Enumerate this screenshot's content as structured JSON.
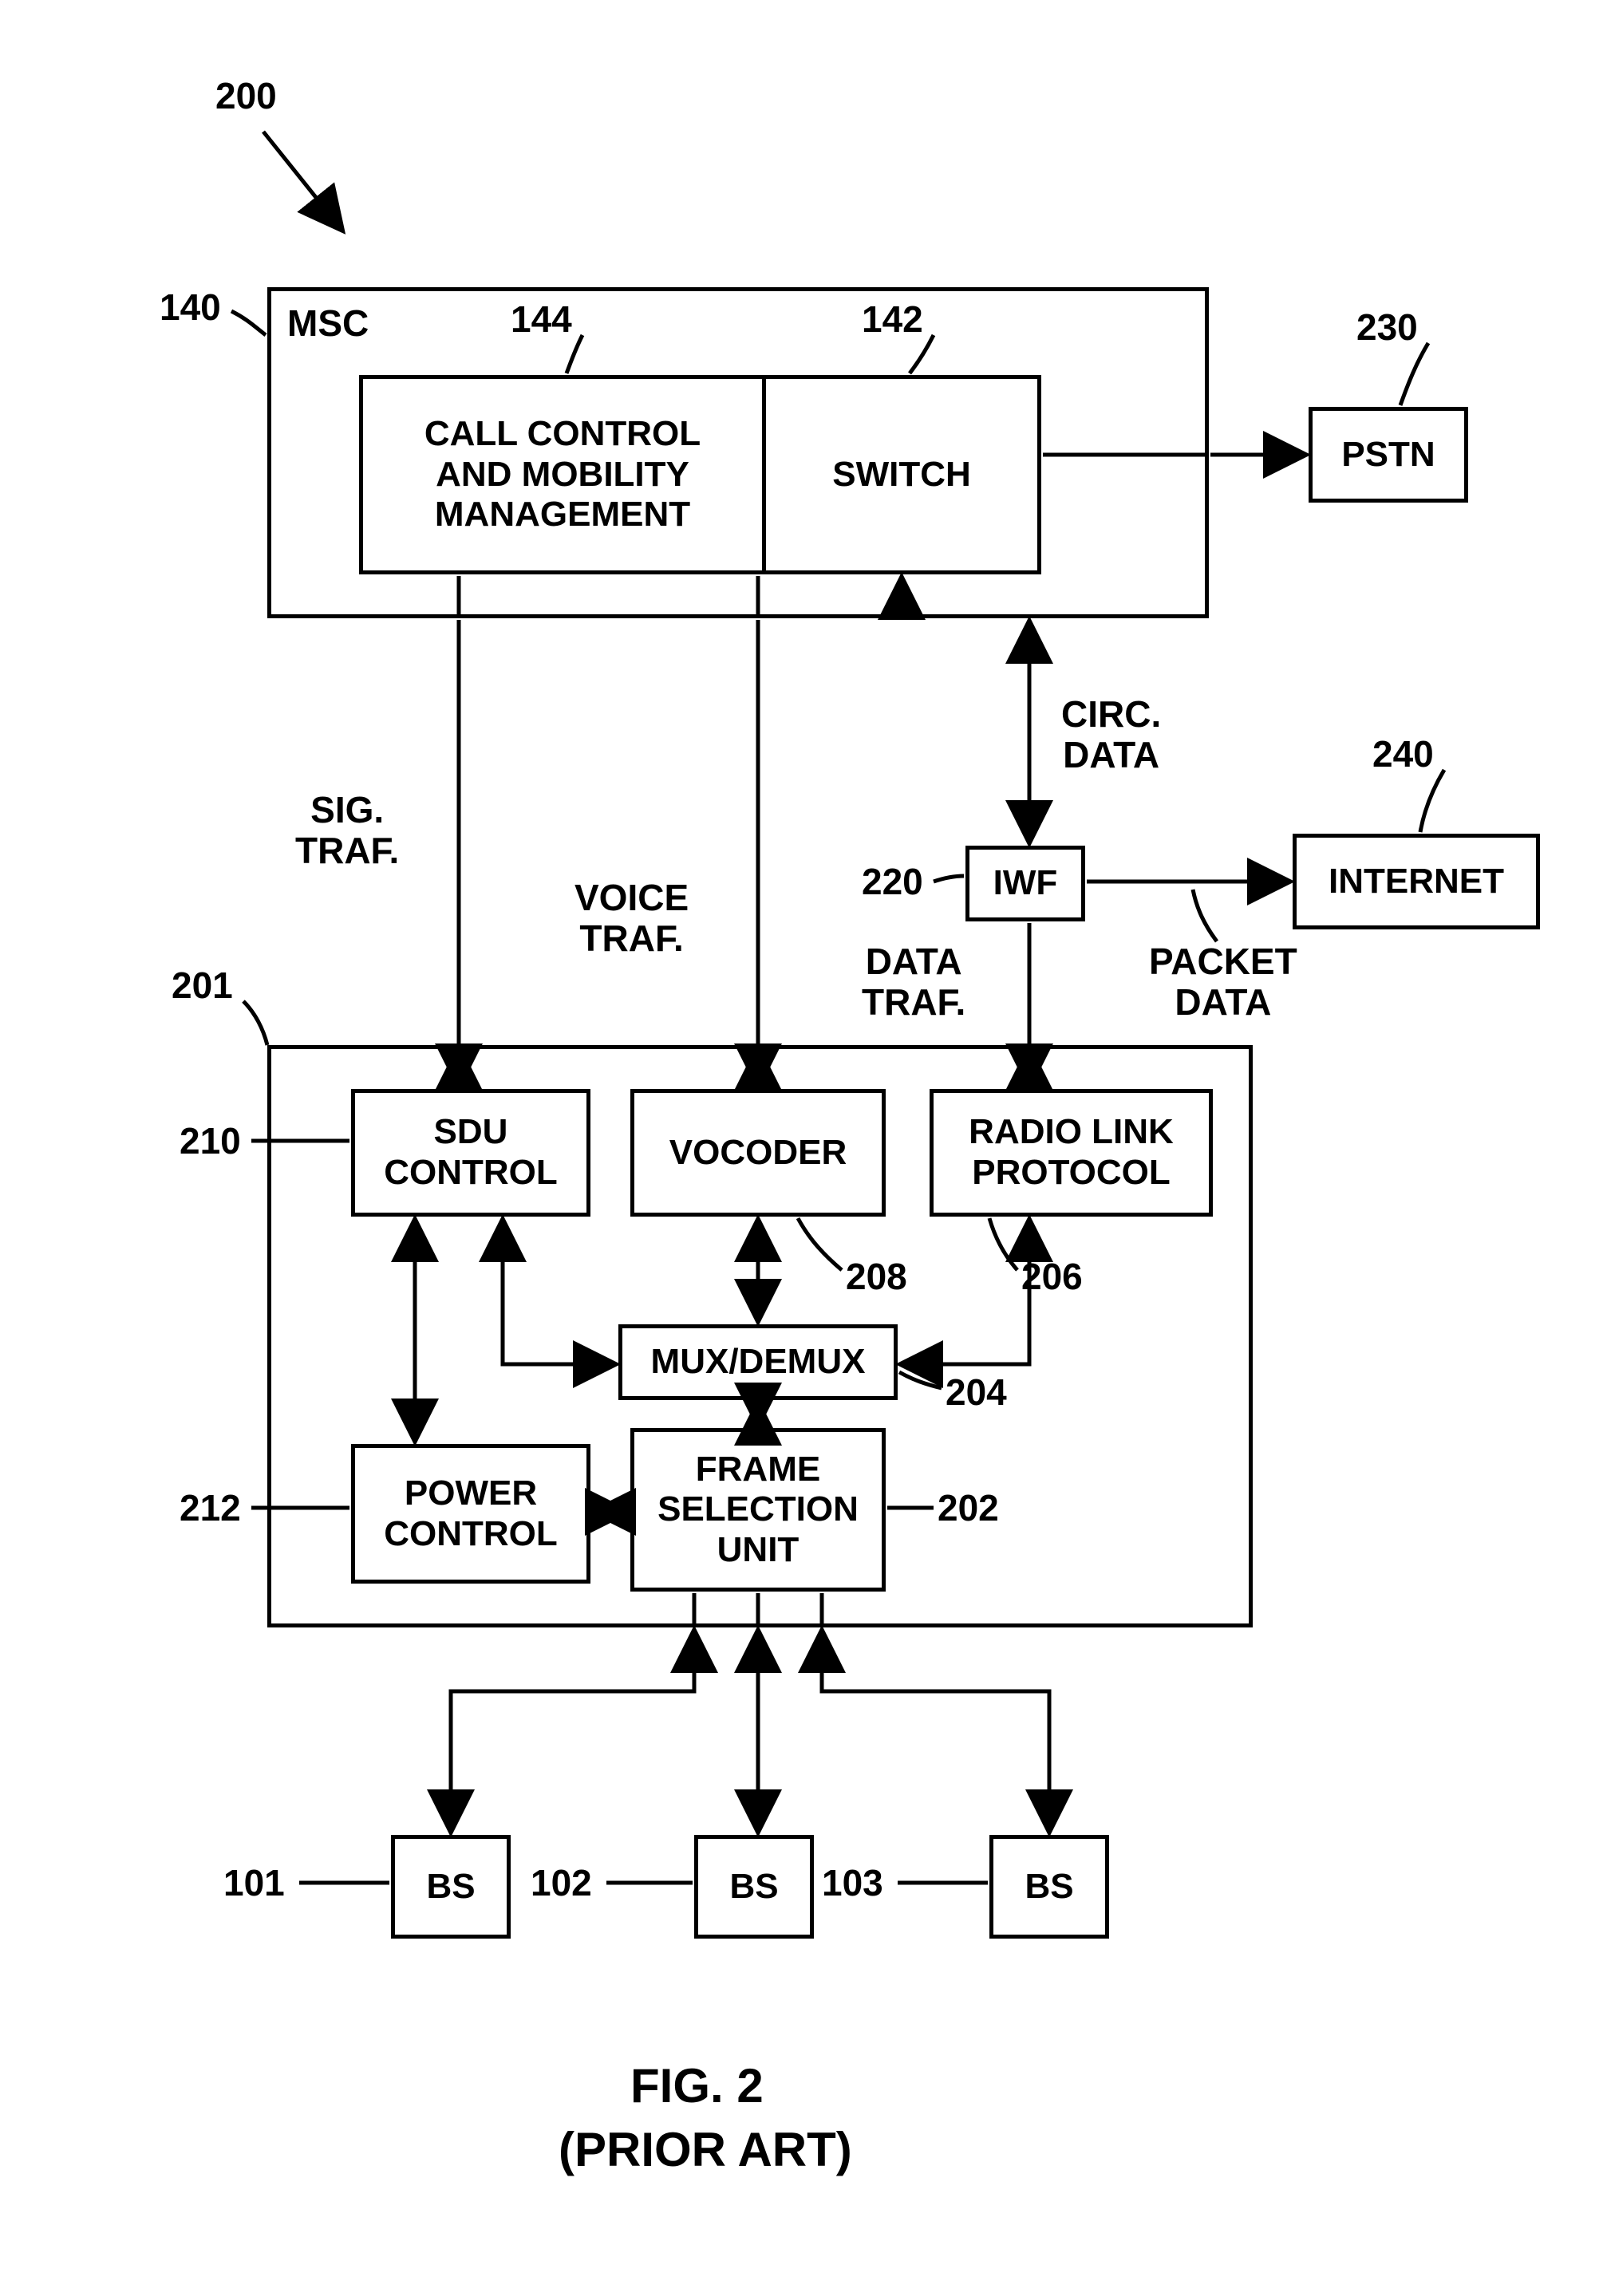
{
  "figure": {
    "ref": "200",
    "title": "FIG. 2",
    "subtitle": "(PRIOR ART)"
  },
  "msc": {
    "ref": "140",
    "label": "MSC",
    "call_ctrl": {
      "ref": "144",
      "label": "CALL CONTROL\nAND MOBILITY\nMANAGEMENT"
    },
    "switch": {
      "ref": "142",
      "label": "SWITCH"
    }
  },
  "pstn": {
    "ref": "230",
    "label": "PSTN"
  },
  "internet": {
    "ref": "240",
    "label": "INTERNET"
  },
  "iwf": {
    "ref": "220",
    "label": "IWF"
  },
  "links": {
    "sig_traf": "SIG.\nTRAF.",
    "voice_traf": "VOICE\nTRAF.",
    "data_traf": "DATA\nTRAF.",
    "circ_data": "CIRC.\nDATA",
    "packet_data": "PACKET\nDATA"
  },
  "sdu_group": {
    "ref": "201",
    "sdu_control": {
      "ref": "210",
      "label": "SDU\nCONTROL"
    },
    "vocoder": {
      "ref": "208",
      "label": "VOCODER"
    },
    "rlp": {
      "ref": "206",
      "label": "RADIO LINK\nPROTOCOL"
    },
    "mux": {
      "ref": "204",
      "label": "MUX/DEMUX"
    },
    "power_ctrl": {
      "ref": "212",
      "label": "POWER\nCONTROL"
    },
    "fsu": {
      "ref": "202",
      "label": "FRAME\nSELECTION\nUNIT"
    }
  },
  "bs": [
    {
      "ref": "101",
      "label": "BS"
    },
    {
      "ref": "102",
      "label": "BS"
    },
    {
      "ref": "103",
      "label": "BS"
    }
  ]
}
